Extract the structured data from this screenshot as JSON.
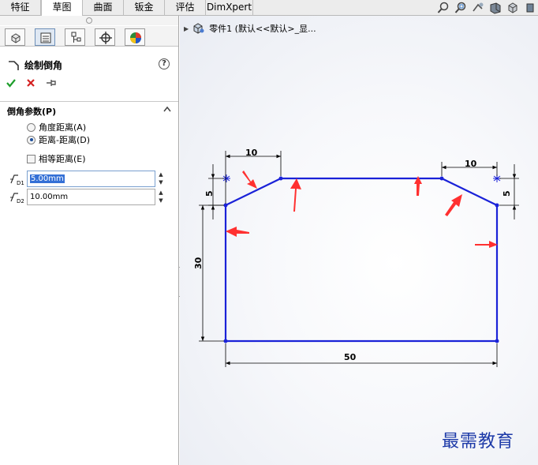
{
  "tabs": [
    {
      "label": "特征",
      "active": false
    },
    {
      "label": "草图",
      "active": true
    },
    {
      "label": "曲面",
      "active": false
    },
    {
      "label": "钣金",
      "active": false
    },
    {
      "label": "评估",
      "active": false
    },
    {
      "label": "DimXpert",
      "active": false
    }
  ],
  "view_tools": [
    "zoom-to-fit-icon",
    "zoom-area-icon",
    "previous-view-icon",
    "section-view-icon",
    "view-orientation-icon",
    "display-style-icon"
  ],
  "panel": {
    "title": "绘制倒角",
    "help_label": "?",
    "group_label": "倒角参数(P)",
    "options": [
      {
        "label": "角度距离(A)",
        "selected": false
      },
      {
        "label": "距离-距离(D)",
        "selected": true
      }
    ],
    "equal_distance_label": "相等距离(E)",
    "equal_distance_checked": false,
    "distance1": {
      "value_selected": "5.00mm",
      "icon_label": "D1"
    },
    "distance2": {
      "value": "10.00mm",
      "icon_label": "D2"
    }
  },
  "tree": {
    "part_label": "零件1  (默认<<默认>_显..."
  },
  "dimensions": {
    "top_left_width": "10",
    "top_right_width": "10",
    "left_chamfer_height": "5",
    "right_chamfer_height": "5",
    "height": "30",
    "width": "50"
  },
  "watermark": "最需教育",
  "colors": {
    "sketch_line": "#1a22d8",
    "dimension": "#000000",
    "arrow": "#ff3030",
    "ok": "#1e9e2c",
    "cancel": "#d42020"
  }
}
